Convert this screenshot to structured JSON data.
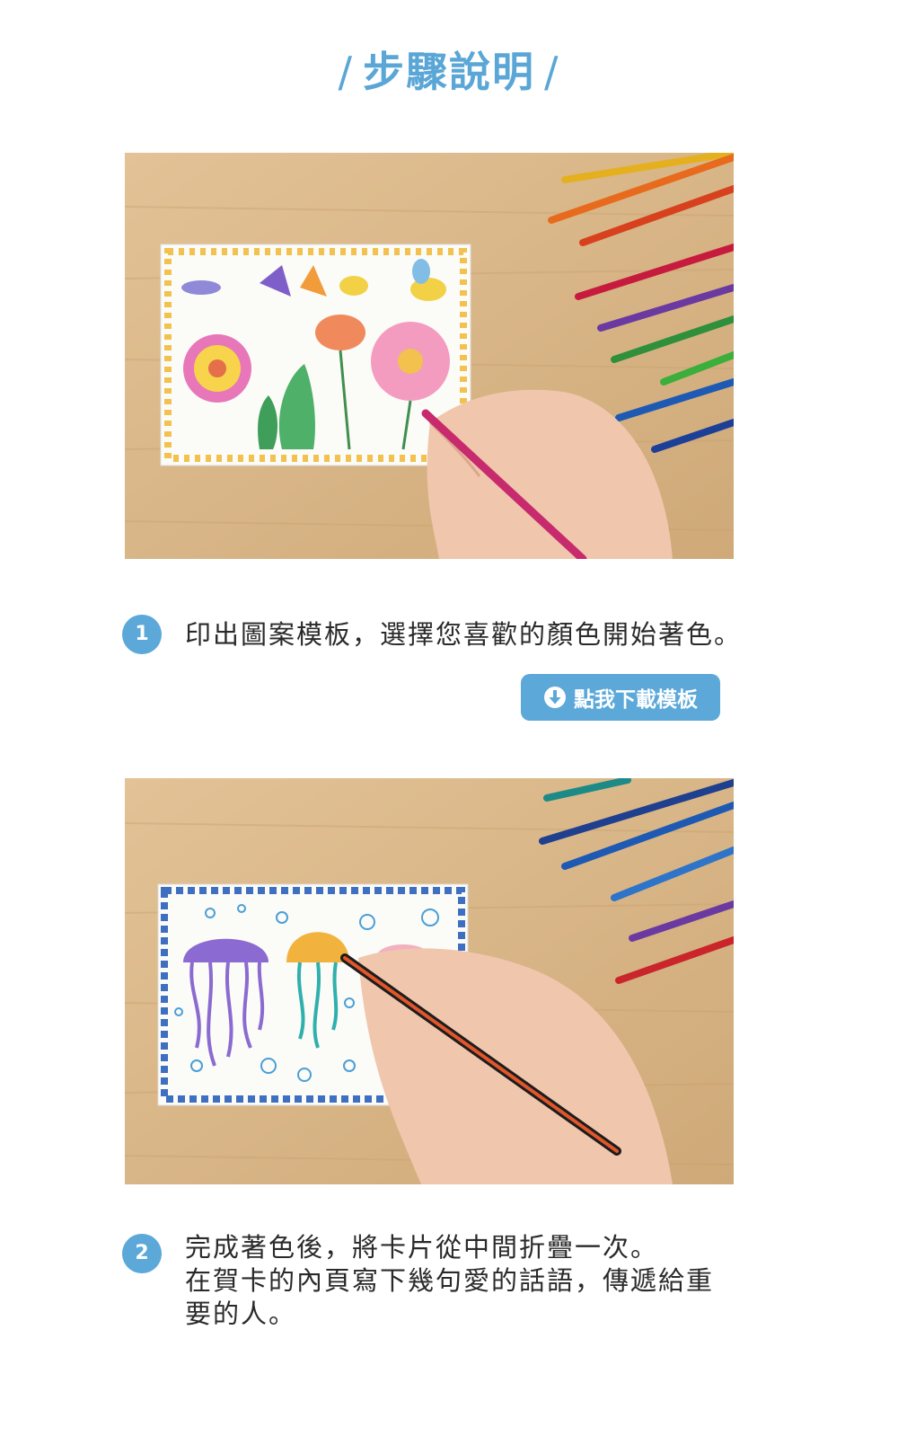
{
  "header": {
    "slash_left": "/",
    "title": "步驟說明",
    "slash_right": "/"
  },
  "steps": [
    {
      "number": "1",
      "lines": [
        "印出圖案模板，選擇您喜歡的顏色開始著色。"
      ]
    },
    {
      "number": "2",
      "lines": [
        "完成著色後，將卡片從中間折疊一次。",
        "在賀卡的內頁寫下幾句愛的話語，傳遞給重",
        "要的人。"
      ]
    }
  ],
  "download_button": {
    "label": "點我下載模板",
    "icon": "download-arrow-icon"
  },
  "colors": {
    "accent": "#5ba8d9",
    "title": "#5aa6d6",
    "wood": "#dcb98c"
  }
}
